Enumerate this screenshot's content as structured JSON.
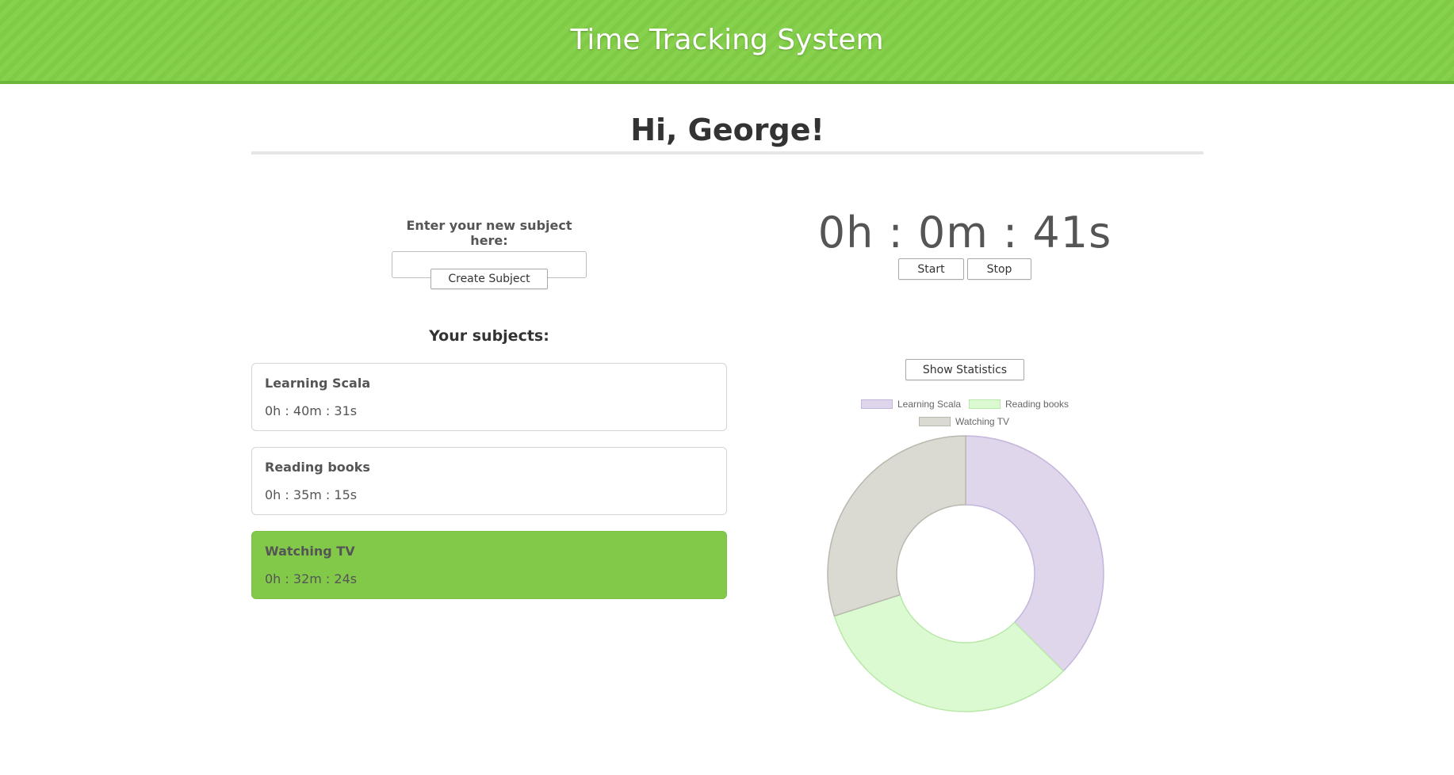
{
  "header": {
    "title": "Time Tracking System",
    "color": "#82cf46"
  },
  "greeting": "Hi, George!",
  "new_subject": {
    "label": "Enter your new subject here:",
    "value": "",
    "placeholder": "",
    "create_label": "Create Subject"
  },
  "subjects": {
    "title": "Your subjects:",
    "items": [
      {
        "name": "Learning Scala",
        "time": "0h : 40m : 31s",
        "active": false
      },
      {
        "name": "Reading books",
        "time": "0h : 35m : 15s",
        "active": false
      },
      {
        "name": "Watching TV",
        "time": "0h : 32m : 24s",
        "active": true
      }
    ]
  },
  "timer": {
    "display": "0h : 0m : 41s",
    "start_label": "Start",
    "stop_label": "Stop"
  },
  "stats": {
    "button_label": "Show Statistics"
  },
  "chart_data": {
    "type": "pie",
    "title": "",
    "legend_position": "top",
    "hole": true,
    "labels": [
      "Learning Scala",
      "Reading books",
      "Watching TV"
    ],
    "values": [
      2431,
      2115,
      1944
    ],
    "colors": [
      {
        "fill": "#e0d6ec",
        "stroke": "#c4b5dc"
      },
      {
        "fill": "#dcfad2",
        "stroke": "#b8e8a8"
      },
      {
        "fill": "#dadad2",
        "stroke": "#b8b8ae"
      }
    ]
  }
}
